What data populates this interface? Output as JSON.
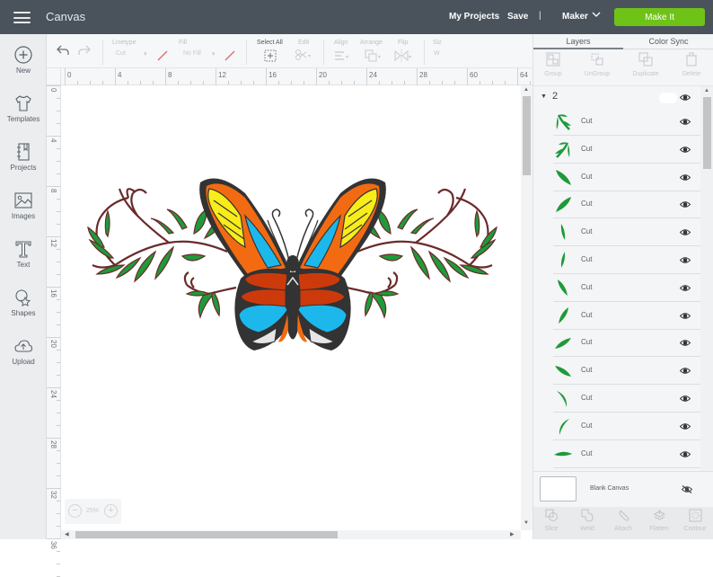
{
  "header": {
    "title": "Canvas",
    "my_projects": "My Projects",
    "save": "Save",
    "separator": "|",
    "machine": "Maker",
    "make_it": "Make It",
    "accent_color": "#6fc218"
  },
  "sidebar": {
    "items": [
      {
        "label": "New",
        "icon": "plus-circle-icon"
      },
      {
        "label": "Templates",
        "icon": "tshirt-icon"
      },
      {
        "label": "Projects",
        "icon": "notebook-icon"
      },
      {
        "label": "Images",
        "icon": "image-icon"
      },
      {
        "label": "Text",
        "icon": "text-icon"
      },
      {
        "label": "Shapes",
        "icon": "shapes-icon"
      },
      {
        "label": "Upload",
        "icon": "cloud-upload-icon"
      }
    ]
  },
  "toolbar": {
    "linetype_label": "Linetype",
    "linetype_value": "Cut",
    "fill_label": "Fill",
    "fill_value": "No Fill",
    "select_all": "Select All",
    "edit": "Edit",
    "align": "Align",
    "arrange": "Arrange",
    "flip": "Flip",
    "size": "Siz",
    "size_w": "W"
  },
  "rulers": {
    "top": [
      "0",
      "4",
      "8",
      "12",
      "16",
      "20",
      "24",
      "28",
      "60",
      "64"
    ],
    "left": [
      "0",
      "4",
      "8",
      "12",
      "16",
      "20",
      "24",
      "28",
      "32",
      "36"
    ]
  },
  "zoom": {
    "value": "25%",
    "minus": "−",
    "plus": "+"
  },
  "panel": {
    "tabs": [
      {
        "label": "Layers",
        "active": true
      },
      {
        "label": "Color Sync",
        "active": false
      }
    ],
    "tools": [
      {
        "label": "Group",
        "icon": "group-icon"
      },
      {
        "label": "UnGroup",
        "icon": "ungroup-icon"
      },
      {
        "label": "Duplicate",
        "icon": "duplicate-icon"
      },
      {
        "label": "Delete",
        "icon": "trash-icon"
      }
    ],
    "group_name": "2",
    "layers": [
      {
        "name": "Cut",
        "shape": "sprig-left"
      },
      {
        "name": "Cut",
        "shape": "sprig-right"
      },
      {
        "name": "Cut",
        "shape": "leaf-diag-down"
      },
      {
        "name": "Cut",
        "shape": "leaf-diag-up"
      },
      {
        "name": "Cut",
        "shape": "leaf-thin-vertical"
      },
      {
        "name": "Cut",
        "shape": "leaf-thin-vertical-2"
      },
      {
        "name": "Cut",
        "shape": "leaf-diag-down-small"
      },
      {
        "name": "Cut",
        "shape": "leaf-diag-up-small"
      },
      {
        "name": "Cut",
        "shape": "leaf-flat-up"
      },
      {
        "name": "Cut",
        "shape": "leaf-flat-down"
      },
      {
        "name": "Cut",
        "shape": "leaf-curve-right"
      },
      {
        "name": "Cut",
        "shape": "leaf-curve-left"
      },
      {
        "name": "Cut",
        "shape": "leaf-horizontal"
      }
    ],
    "leaf_color": "#1e9a3a",
    "blank_canvas": "Blank Canvas",
    "bottom_tools": [
      {
        "label": "Slice",
        "icon": "slice-icon"
      },
      {
        "label": "Weld",
        "icon": "weld-icon"
      },
      {
        "label": "Attach",
        "icon": "attach-icon"
      },
      {
        "label": "Flatten",
        "icon": "flatten-icon"
      },
      {
        "label": "Contour",
        "icon": "contour-icon"
      }
    ]
  },
  "artwork": {
    "subject": "Butterfly with leafy vines",
    "colors": {
      "orange": "#f26b12",
      "yellow": "#f8ec1a",
      "blue": "#1cb8ec",
      "red": "#cc3a0c",
      "body": "#333333",
      "white": "#e6e6e6",
      "leaf": "#1e9a3a",
      "vine": "#6b2b2b"
    }
  }
}
